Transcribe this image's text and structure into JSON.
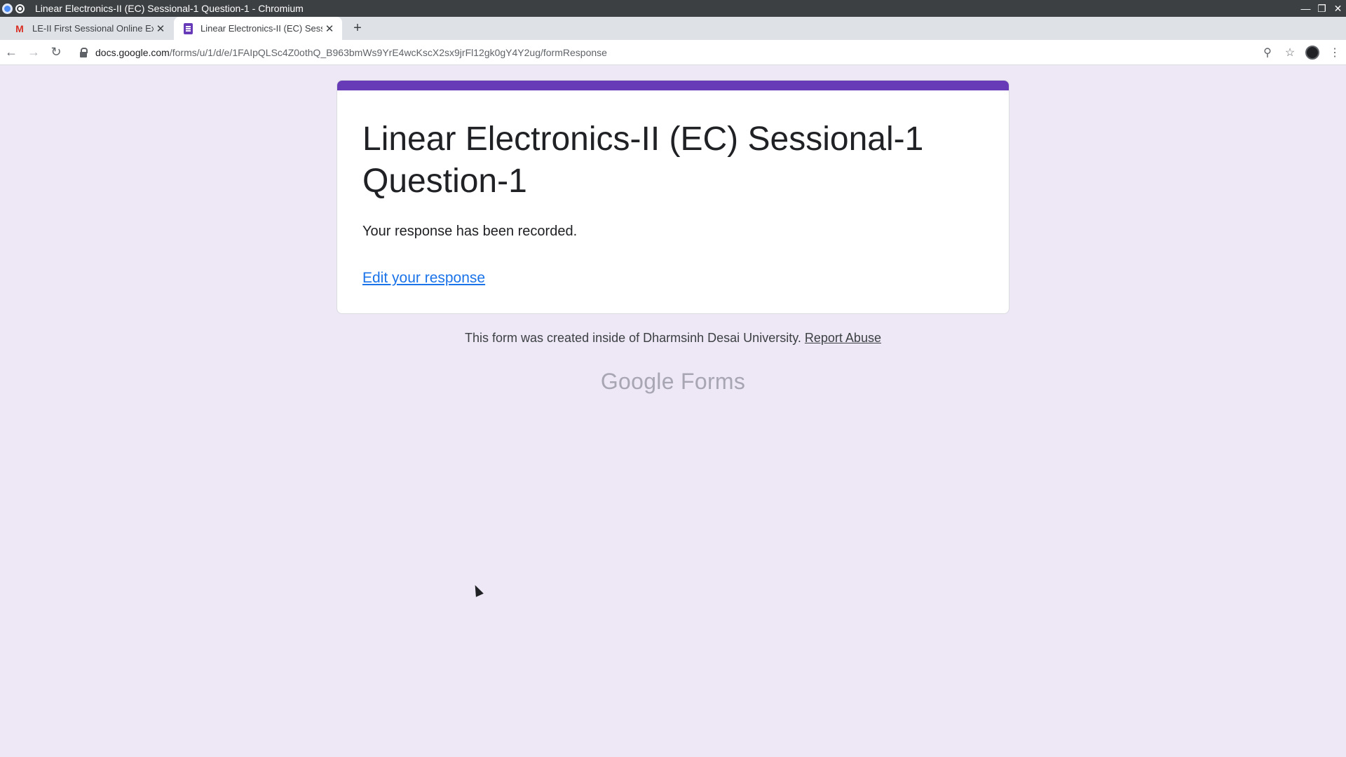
{
  "window": {
    "title": "Linear Electronics-II (EC) Sessional-1 Question-1 - Chromium",
    "controls": [
      "minimize",
      "maximize",
      "close"
    ]
  },
  "tabs": [
    {
      "label": "LE-II First Sessional Online Ex",
      "icon": "gmail-icon",
      "active": false
    },
    {
      "label": "Linear Electronics-II (EC) Sess",
      "icon": "forms-icon",
      "active": true
    }
  ],
  "toolbar": {
    "url_host": "docs.google.com",
    "url_path": "/forms/u/1/d/e/1FAIpQLSc4Z0othQ_B963bmWs9YrE4wcKscX2sx9jrFl12gk0gY4Y2ug/formResponse"
  },
  "form": {
    "title": "Linear Electronics-II (EC) Sessional-1 Question-1",
    "confirmation": "Your response has been recorded.",
    "edit_link": "Edit your response",
    "accent_color": "#673ab7"
  },
  "footer": {
    "note": "This form was created inside of Dharmsinh Desai University.",
    "report_link": "Report Abuse",
    "brand_google": "Google",
    "brand_product": "Forms"
  }
}
